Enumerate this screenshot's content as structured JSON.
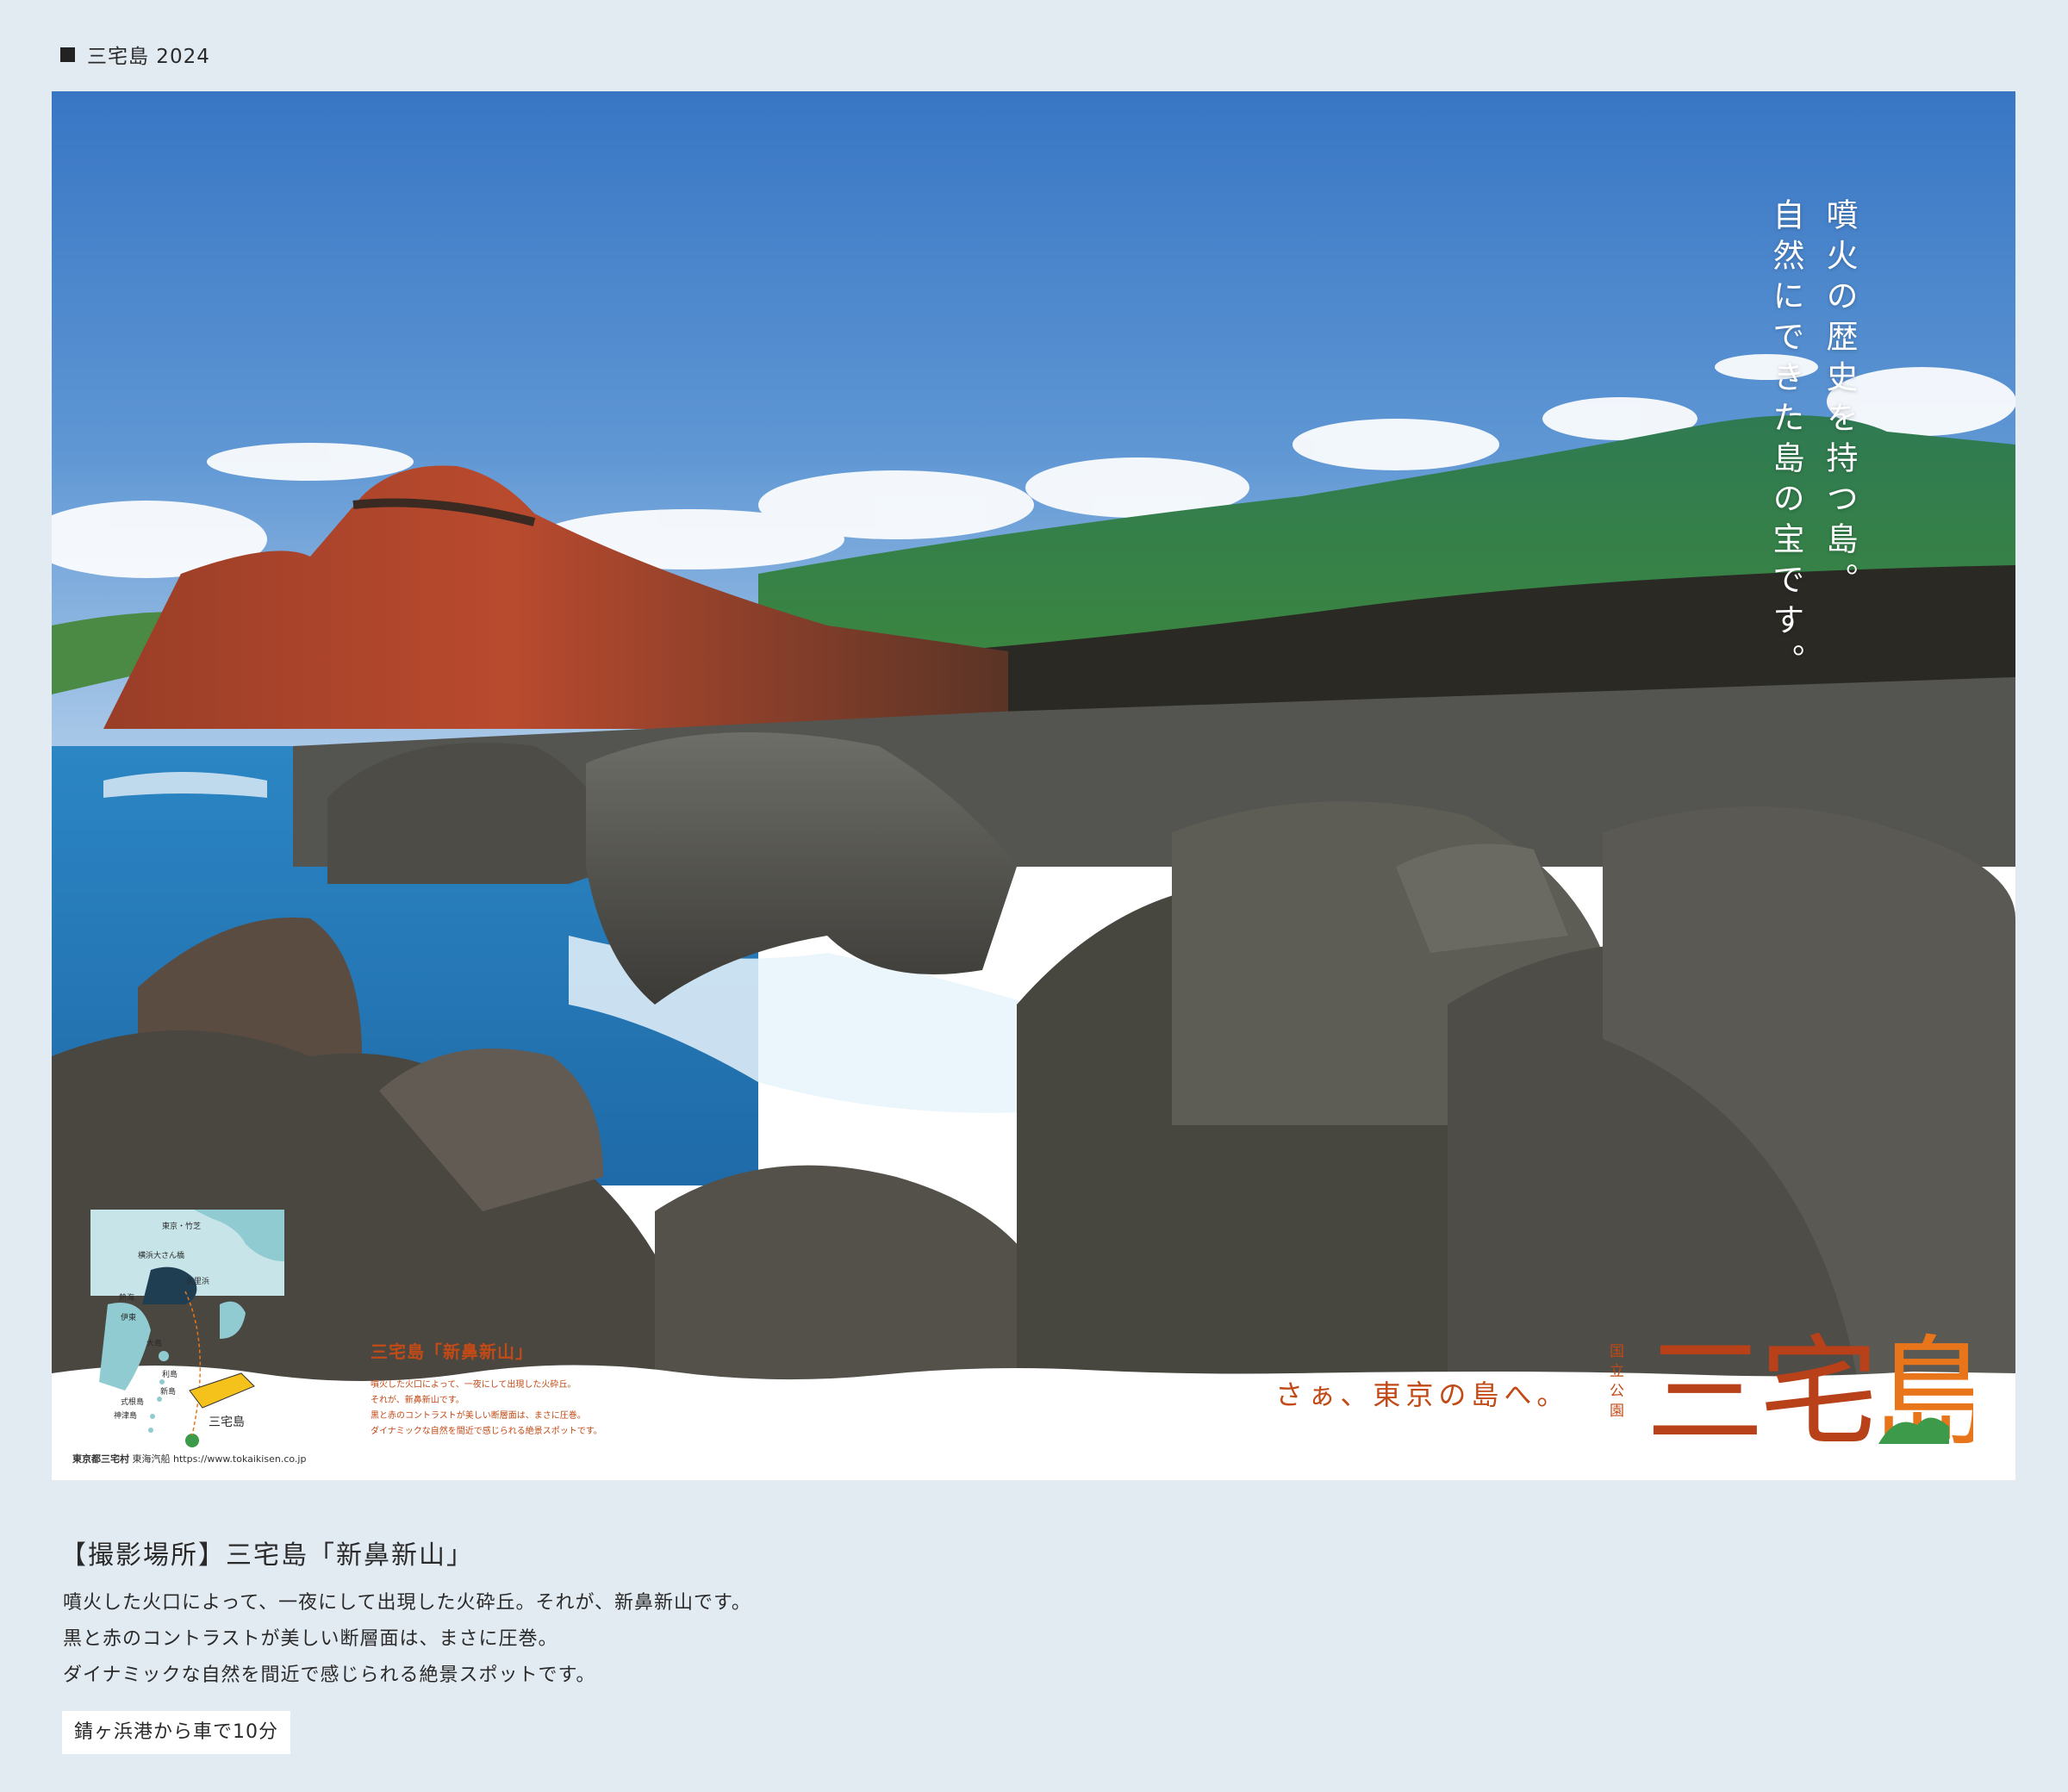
{
  "header": {
    "label": "三宅島 2024"
  },
  "poster": {
    "tagline_lines": [
      "噴火の歴史を持つ島。",
      "自然にできた島の宝です。"
    ],
    "map": {
      "places": [
        "東京・竹芝",
        "横浜大さん橋",
        "久里浜",
        "熱海",
        "伊東",
        "大島",
        "利島",
        "新島",
        "式根島",
        "神津島",
        "三宅島"
      ],
      "copyright": "東京都三宅村",
      "operator": "東海汽船",
      "url": "https://www.tokaikisen.co.jp"
    },
    "caption": {
      "title": "三宅島「新鼻新山」",
      "lines": [
        "噴火した火口によって、一夜にして出現した火砕丘。",
        "それが、新鼻新山です。",
        "黒と赤のコントラストが美しい断層面は、まさに圧巻。",
        "ダイナミックな自然を間近で感じられる絶景スポットです。"
      ]
    },
    "slogan": "さぁ、東京の島へ。",
    "park_label": "国立公園",
    "logo_text": "三宅島",
    "colors": {
      "logo_dark": "#b8411a",
      "logo_orange": "#e8751a",
      "logo_green": "#3c9a4a",
      "text_orange": "#c24a16"
    }
  },
  "description": {
    "title": "【撮影場所】三宅島「新鼻新山」",
    "lines": [
      "噴火した火口によって、一夜にして出現した火砕丘。それが、新鼻新山です。",
      "黒と赤のコントラストが美しい断層面は、まさに圧巻。",
      "ダイナミックな自然を間近で感じられる絶景スポットです。"
    ]
  },
  "access": {
    "label": "錆ヶ浜港から車で10分"
  }
}
